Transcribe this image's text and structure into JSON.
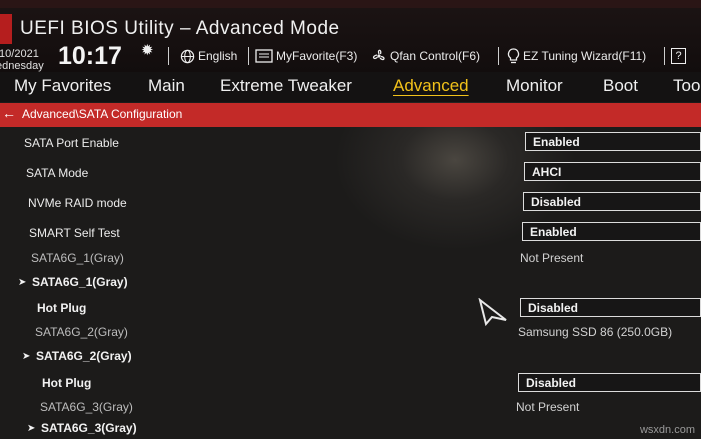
{
  "header": {
    "title": "UEFI BIOS Utility – Advanced Mode",
    "date": "/10/2021",
    "day": "ednesday",
    "time": "10:17",
    "items": [
      {
        "label": "English",
        "icon": "globe-icon"
      },
      {
        "label": "MyFavorite(F3)",
        "icon": "favorite-icon"
      },
      {
        "label": "Qfan Control(F6)",
        "icon": "fan-icon"
      },
      {
        "label": "EZ Tuning Wizard(F11)",
        "icon": "bulb-icon"
      },
      {
        "label": "?",
        "icon": "help-icon"
      }
    ]
  },
  "nav": {
    "tabs": [
      "My Favorites",
      "Main",
      "Extreme Tweaker",
      "Advanced",
      "Monitor",
      "Boot",
      "Too"
    ],
    "active": "Advanced",
    "active_color": "#f2c21a"
  },
  "breadcrumb": {
    "text": "Advanced\\SATA Configuration",
    "bar_color": "#c32a28"
  },
  "rows": [
    {
      "label": "SATA Port Enable",
      "value": "Enabled",
      "kind": "dropdown"
    },
    {
      "label": "SATA Mode",
      "value": "AHCI",
      "kind": "dropdown"
    },
    {
      "label": "NVMe RAID mode",
      "value": "Disabled",
      "kind": "dropdown"
    },
    {
      "label": "SMART Self Test",
      "value": "Enabled",
      "kind": "dropdown"
    },
    {
      "label": "SATA6G_1(Gray)",
      "value": "Not Present",
      "kind": "info"
    },
    {
      "label": "SATA6G_1(Gray)",
      "kind": "submenu"
    },
    {
      "label": "Hot Plug",
      "value": "Disabled",
      "kind": "dropdown"
    },
    {
      "label": "SATA6G_2(Gray)",
      "value": "Samsung SSD 86 (250.0GB)",
      "kind": "info"
    },
    {
      "label": "SATA6G_2(Gray)",
      "kind": "submenu"
    },
    {
      "label": "Hot Plug",
      "value": "Disabled",
      "kind": "dropdown"
    },
    {
      "label": "SATA6G_3(Gray)",
      "value": "Not Present",
      "kind": "info"
    },
    {
      "label": "SATA6G_3(Gray)",
      "kind": "submenu"
    }
  ],
  "watermark": "wsxdn.com"
}
